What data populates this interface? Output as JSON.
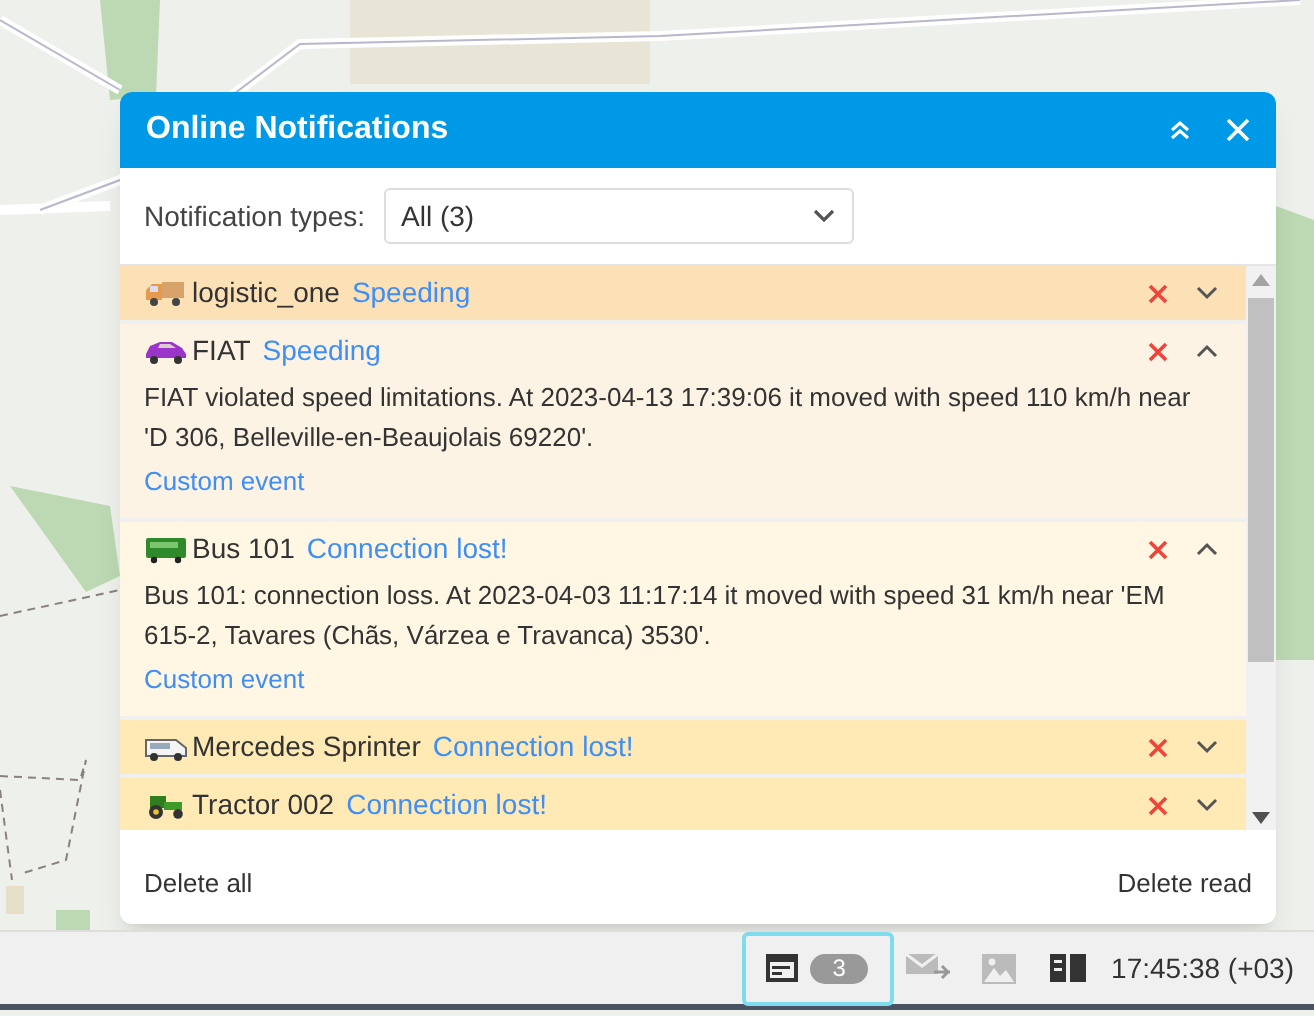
{
  "popup": {
    "title": "Online Notifications",
    "filter": {
      "label": "Notification types:",
      "value": "All (3)"
    },
    "notifications": [
      {
        "vehicle": "logistic_one",
        "kind": "speeding",
        "event": "Speeding",
        "expanded": false
      },
      {
        "vehicle": "FIAT",
        "kind": "speeding",
        "event": "Speeding",
        "expanded": true,
        "message": "FIAT violated speed limitations. At 2023-04-13 17:39:06 it moved with speed 110 km/h near 'D 306, Belleville-en-Beaujolais 69220'.",
        "link": "Custom event"
      },
      {
        "vehicle": "Bus 101",
        "kind": "connection",
        "event": "Connection lost!",
        "expanded": true,
        "message": "Bus 101: connection loss. At 2023-04-03 11:17:14 it moved with speed 31 km/h near 'EM 615-2, Tavares (Chãs, Várzea e Travanca) 3530'.",
        "link": "Custom event"
      },
      {
        "vehicle": "Mercedes Sprinter",
        "kind": "connection",
        "event": "Connection lost!",
        "expanded": false
      },
      {
        "vehicle": "Tractor 002",
        "kind": "connection",
        "event": "Connection lost!",
        "expanded": false
      }
    ],
    "footer": {
      "delete_all": "Delete all",
      "delete_read": "Delete read"
    }
  },
  "status_bar": {
    "notification_count": "3",
    "time": "17:45:38 (+03)"
  }
}
